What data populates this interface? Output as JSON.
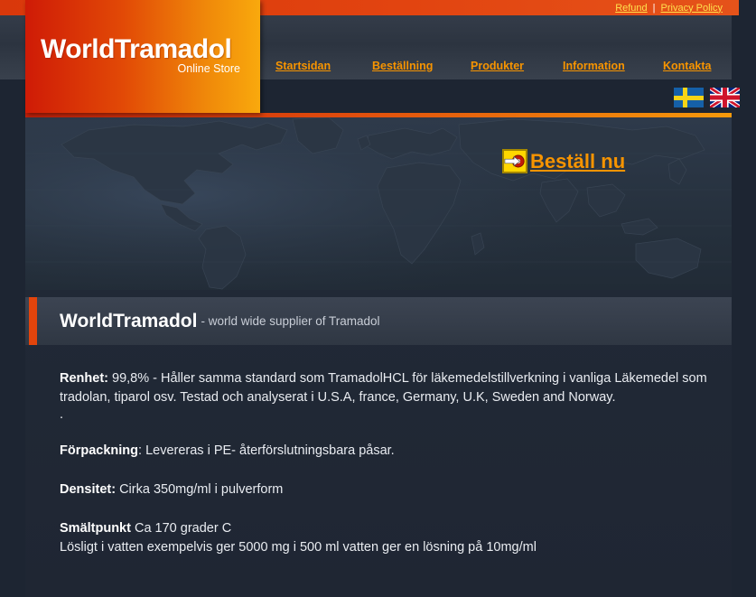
{
  "topbar": {
    "refund_label": "Refund",
    "separator": "|",
    "privacy_label": "Privacy Policy",
    "background_color": "#e2440c",
    "link_color": "#ffe14d"
  },
  "logo": {
    "title": "WorldTramadol",
    "subtitle": "Online Store",
    "gradient_start": "#cf1b06",
    "gradient_end": "#f9a90d"
  },
  "nav": {
    "items": [
      {
        "label": "Startsidan"
      },
      {
        "label": "Beställning"
      },
      {
        "label": "Produkter"
      },
      {
        "label": "Information"
      },
      {
        "label": "Kontakta"
      }
    ],
    "link_color": "#f79400"
  },
  "flags": [
    {
      "name": "swedish-flag",
      "alt": "Svenska"
    },
    {
      "name": "uk-flag",
      "alt": "English"
    }
  ],
  "banner": {
    "map_name": "world-map-background",
    "cta": {
      "icon": "arrow-into-target-icon",
      "label": "Beställ nu"
    }
  },
  "content": {
    "heading_strong": "WorldTramadol",
    "heading_sub": "- world wide supplier of Tramadol",
    "accent_color": "#e2440c",
    "paragraphs": [
      {
        "label": "Renhet:",
        "text": " 99,8% - Håller samma standard som TramadolHCL för läkemedelstillverkning i vanliga Läkemedel som tradolan, tiparol osv. Testad och analyserat i U.S.A, france, Germany, U.K, Sweden and Norway."
      },
      {
        "label": ".",
        "text": ""
      },
      {
        "label": "Förpackning",
        "text": ": Levereras i PE- återförslutningsbara påsar."
      },
      {
        "label": "Densitet:",
        "text": " Cirka 350mg/ml i pulverform"
      },
      {
        "label": "Smältpunkt",
        "text": " Ca 170 grader C"
      },
      {
        "label": "",
        "text": "Lösligt i vatten exempelvis ger 5000 mg i 500 ml vatten ger en lösning på 10mg/ml"
      }
    ]
  }
}
